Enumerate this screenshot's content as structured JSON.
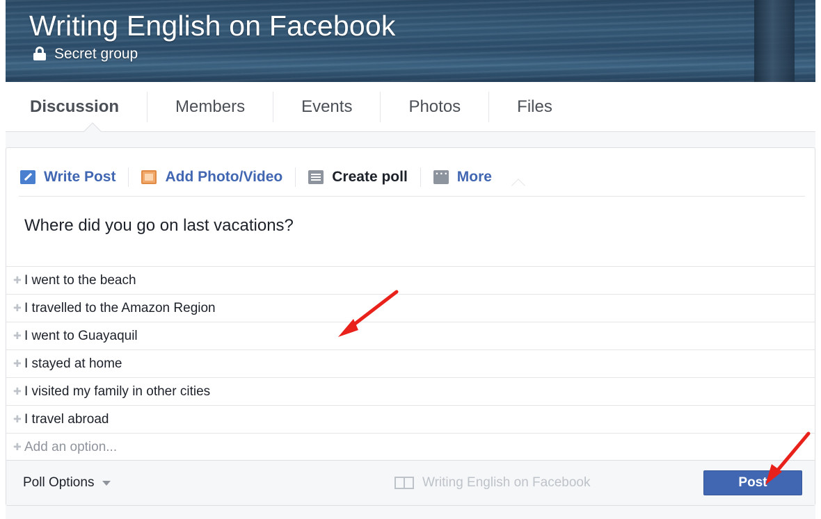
{
  "group": {
    "title": "Writing English on Facebook",
    "privacy": "Secret group"
  },
  "tabs": [
    {
      "label": "Discussion",
      "active": true
    },
    {
      "label": "Members"
    },
    {
      "label": "Events"
    },
    {
      "label": "Photos"
    },
    {
      "label": "Files"
    }
  ],
  "composer": {
    "tabs": [
      {
        "label": "Write Post",
        "icon": "pencil-icon"
      },
      {
        "label": "Add Photo/Video",
        "icon": "photo-icon"
      },
      {
        "label": "Create poll",
        "icon": "poll-icon",
        "active": true
      },
      {
        "label": "More",
        "icon": "more-icon"
      }
    ],
    "question": "Where did you go on last vacations?",
    "options": [
      "I went to the beach",
      "I travelled to the Amazon Region",
      "I went to Guayaquil",
      "I stayed at home",
      "I visited my family in other cities",
      "I travel abroad"
    ],
    "add_option_placeholder": "Add an option...",
    "poll_options_label": "Poll Options",
    "audience_label": "Writing English on Facebook",
    "post_label": "Post"
  },
  "colors": {
    "accent": "#4267b2",
    "annotation_arrow": "#e8221b"
  }
}
